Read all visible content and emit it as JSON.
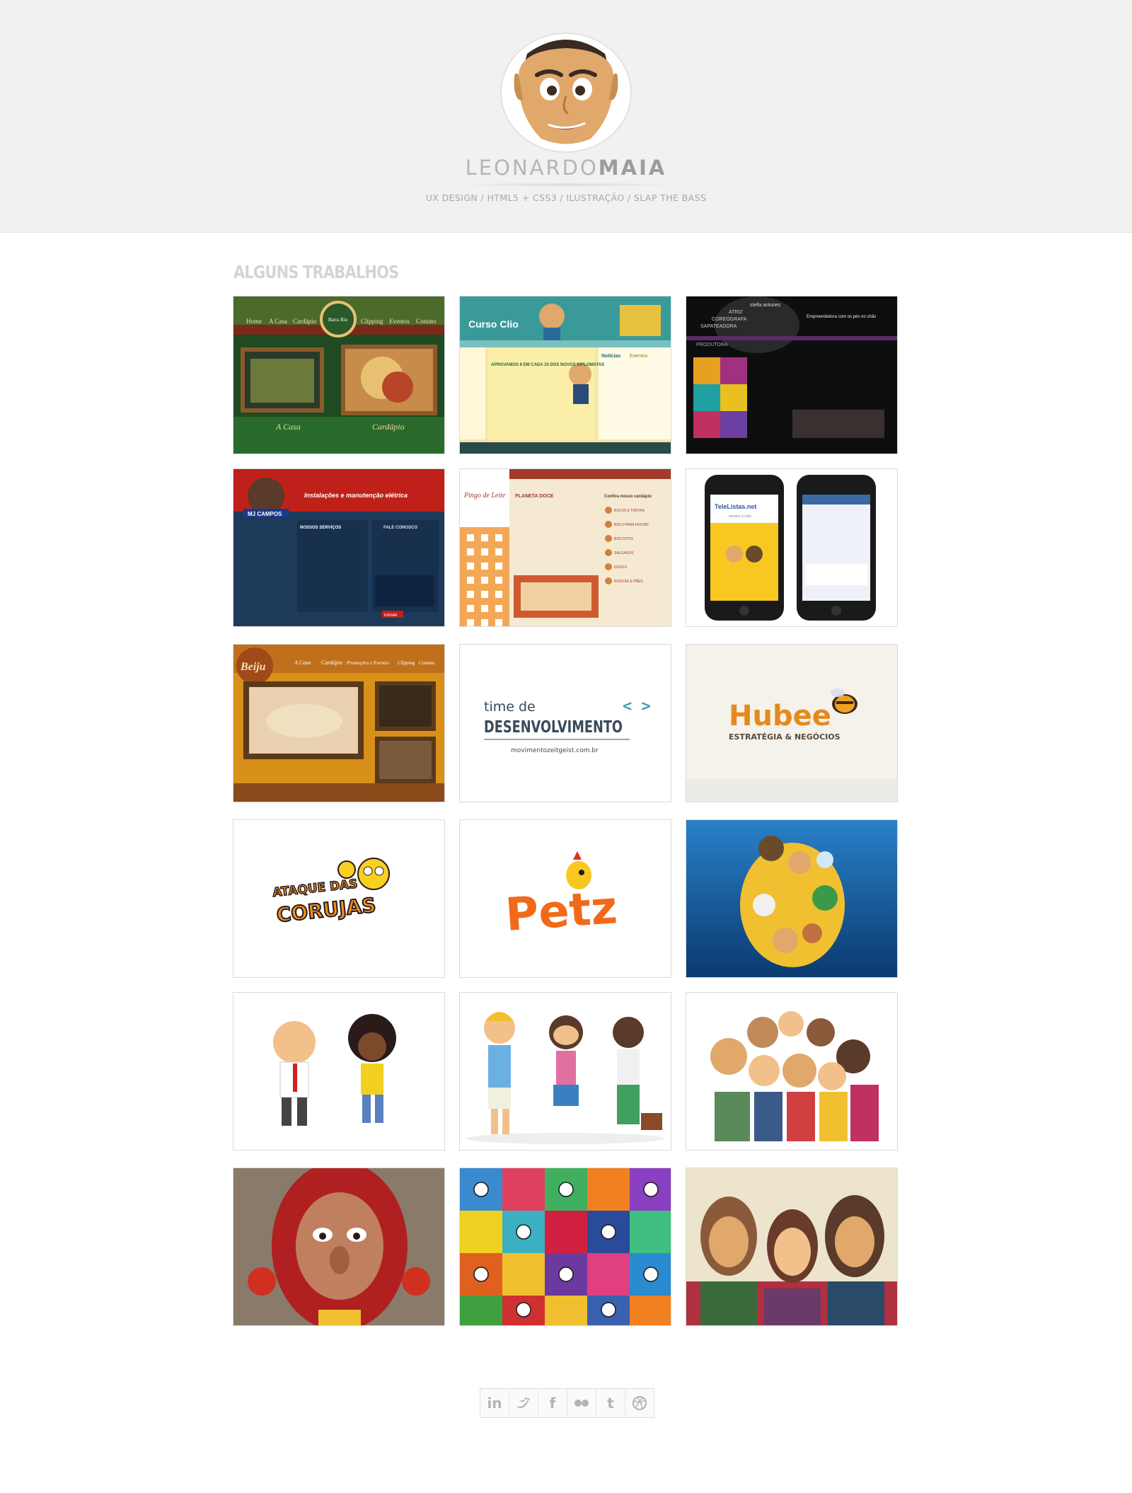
{
  "header": {
    "logo_first": "LEONARDO",
    "logo_last": "MAIA",
    "tagline": "UX DESIGN / HTML5 + CSS3 / ILUSTRAÇÃO / SLAP THE BASS"
  },
  "portfolio": {
    "title": "ALGUNS TRABALHOS",
    "items": [
      {
        "kind": "website",
        "nav": [
          "Home",
          "A Casa",
          "Cardápio",
          "Clipping",
          "Eventos",
          "Contato"
        ],
        "labels": [
          "A Casa",
          "Cardápio"
        ],
        "badge": "Barra Rio"
      },
      {
        "kind": "website",
        "brand": "Curso Clio",
        "headline": "APROVAMOS 9 EM CADA 10 DOS NOVOS DIPLOMATAS",
        "tabs": [
          "Notícias",
          "Eventos"
        ]
      },
      {
        "kind": "website",
        "name": "stella antunes",
        "tags": [
          "ATRIZ",
          "COREÓGRAFA",
          "SAPATEADORA",
          "PRODUTORA"
        ],
        "quote": "Empreendedora com os pés no chão"
      },
      {
        "kind": "website",
        "brand": "MJ CAMPOS",
        "headline": "Instalações e manutenção elétrica",
        "panels": [
          "NOSSOS SERVIÇOS",
          "FALE CONOSCO"
        ],
        "button": "ENVIAR"
      },
      {
        "kind": "website",
        "brand": "Pingo de Leite",
        "section": "PLANETA DOCE",
        "menu_title": "Confira nosso cardápio",
        "menu": [
          "BOLOS E TORTAS",
          "BOLO PARA FESTAS",
          "BISCOITOS",
          "SALGADOS",
          "DOCES",
          "ROSCAS E PÃES"
        ]
      },
      {
        "kind": "mobile",
        "app": "TeleListas.net",
        "tagline": "sempre à mão"
      },
      {
        "kind": "website",
        "brand": "Beiju",
        "nav": [
          "A Casa",
          "Cardápio",
          "Promoções e Eventos",
          "Clipping",
          "Contato"
        ]
      },
      {
        "kind": "logo",
        "line1": "time de",
        "line2": "DESENVOLVIMENTO",
        "url": "movimentozeitgeist.com.br",
        "symbol": "< >"
      },
      {
        "kind": "logo",
        "name": "Hubee",
        "tagline": "ESTRATÉGIA & NEGÓCIOS"
      },
      {
        "kind": "logo",
        "line1": "ATAQUE DAS",
        "line2": "CORUJAS"
      },
      {
        "kind": "logo",
        "name": "Petz"
      },
      {
        "kind": "illustration",
        "subject": "characters collage"
      },
      {
        "kind": "illustration",
        "subject": "two cartoon characters"
      },
      {
        "kind": "illustration",
        "subject": "three cartoon characters"
      },
      {
        "kind": "illustration",
        "subject": "group caricatures"
      },
      {
        "kind": "illustration",
        "subject": "hooded caricature"
      },
      {
        "kind": "illustration",
        "subject": "colorful monster pattern"
      },
      {
        "kind": "illustration",
        "subject": "band caricatures"
      }
    ]
  },
  "social": [
    {
      "icon": "linkedin-icon",
      "glyph": "in"
    },
    {
      "icon": "twitter-icon",
      "glyph": "🐦"
    },
    {
      "icon": "facebook-icon",
      "glyph": "f"
    },
    {
      "icon": "flickr-icon",
      "glyph": "••"
    },
    {
      "icon": "tumblr-icon",
      "glyph": "t"
    },
    {
      "icon": "dribbble-icon",
      "glyph": "◎"
    }
  ],
  "colors": {
    "header_bg": "#f1f1f1",
    "logo_text": "#9c9c9c",
    "section_title": "#d4d4d4",
    "thumb_border": "#dadada"
  }
}
